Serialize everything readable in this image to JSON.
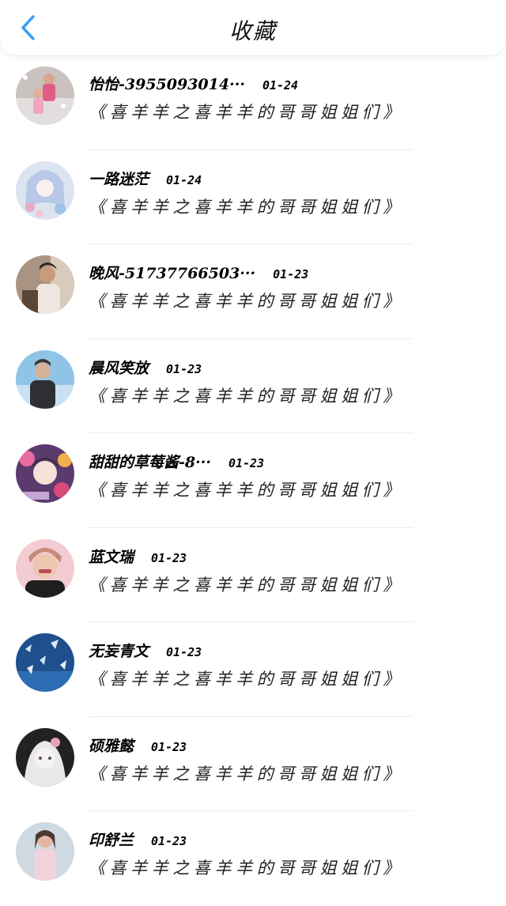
{
  "header": {
    "title": "收藏",
    "back_icon": "chevron-left-icon",
    "accent_color": "#3b9ff5"
  },
  "favorites": [
    {
      "name": "怡怡-3955093014···",
      "date": "01-24",
      "message": "《喜羊羊之喜羊羊的哥哥姐姐们》",
      "avatar": "avatar-photo-children"
    },
    {
      "name": "一路迷茫",
      "date": "01-24",
      "message": "《喜羊羊之喜羊羊的哥哥姐姐们》",
      "avatar": "avatar-anime-girl"
    },
    {
      "name": "晚风-51737766503···",
      "date": "01-23",
      "message": "《喜羊羊之喜羊羊的哥哥姐姐们》",
      "avatar": "avatar-photo-young-man"
    },
    {
      "name": "晨风笑放",
      "date": "01-23",
      "message": "《喜羊羊之喜羊羊的哥哥姐姐们》",
      "avatar": "avatar-photo-man-sky"
    },
    {
      "name": "甜甜的草莓酱-8···",
      "date": "01-23",
      "message": "《喜羊羊之喜羊羊的哥哥姐姐们》",
      "avatar": "avatar-anime-flowers"
    },
    {
      "name": "蓝文瑞",
      "date": "01-23",
      "message": "《喜羊羊之喜羊羊的哥哥姐姐们》",
      "avatar": "avatar-photo-woman"
    },
    {
      "name": "无妄青文",
      "date": "01-23",
      "message": "《喜羊羊之喜羊羊的哥哥姐姐们》",
      "avatar": "avatar-blue-butterflies"
    },
    {
      "name": "硕雅懿",
      "date": "01-23",
      "message": "《喜羊羊之喜羊羊的哥哥姐姐们》",
      "avatar": "avatar-anime-dark"
    },
    {
      "name": "印舒兰",
      "date": "01-23",
      "message": "《喜羊羊之喜羊羊的哥哥姐姐们》",
      "avatar": "avatar-photo-girl"
    }
  ]
}
